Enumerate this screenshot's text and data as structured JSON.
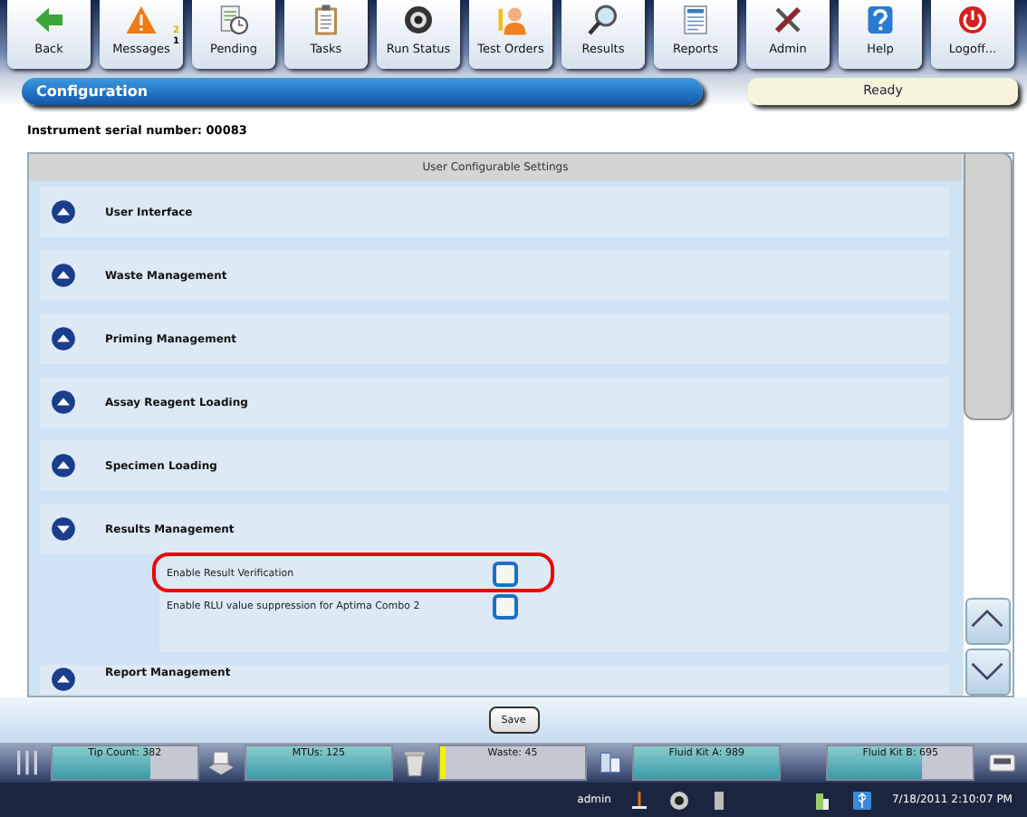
{
  "toolbar": [
    {
      "label": "Back"
    },
    {
      "label": "Messages",
      "badges": [
        "2",
        "1"
      ]
    },
    {
      "label": "Pending"
    },
    {
      "label": "Tasks"
    },
    {
      "label": "Run Status"
    },
    {
      "label": "Test Orders"
    },
    {
      "label": "Results"
    },
    {
      "label": "Reports"
    },
    {
      "label": "Admin"
    },
    {
      "label": "Help"
    },
    {
      "label": "Logoff..."
    }
  ],
  "header": {
    "title": "Configuration",
    "status": "Ready"
  },
  "serial": "Instrument serial number: 00083",
  "panel": {
    "title": "User Configurable Settings",
    "sections": [
      {
        "label": "User Interface",
        "expanded": false
      },
      {
        "label": "Waste Management",
        "expanded": false
      },
      {
        "label": "Priming Management",
        "expanded": false
      },
      {
        "label": "Assay Reagent Loading",
        "expanded": false
      },
      {
        "label": "Specimen Loading",
        "expanded": false
      },
      {
        "label": "Results Management",
        "expanded": true,
        "options": [
          {
            "label": "Enable Result Verification",
            "checked": false,
            "highlighted": true
          },
          {
            "label": "Enable RLU value suppression for Aptima Combo 2",
            "checked": false,
            "highlighted": false
          }
        ]
      },
      {
        "label": "Report Management",
        "expanded": false
      }
    ]
  },
  "save": "Save",
  "meters": [
    {
      "kind": "tips",
      "label": "Tip Count: 382",
      "level": 0.67
    },
    {
      "kind": "mtus",
      "label": "MTUs: 125",
      "level": 1.0
    },
    {
      "kind": "waste",
      "label": "Waste: 45",
      "level": 0.04
    },
    {
      "kind": "fluid",
      "label": "Fluid Kit A: 989",
      "level": 1.0
    },
    {
      "kind": "none",
      "label": "Fluid Kit B: 695",
      "level": 0.65
    }
  ],
  "status_bar": {
    "user": "admin",
    "datetime": "7/18/2011 2:10:07 PM"
  }
}
